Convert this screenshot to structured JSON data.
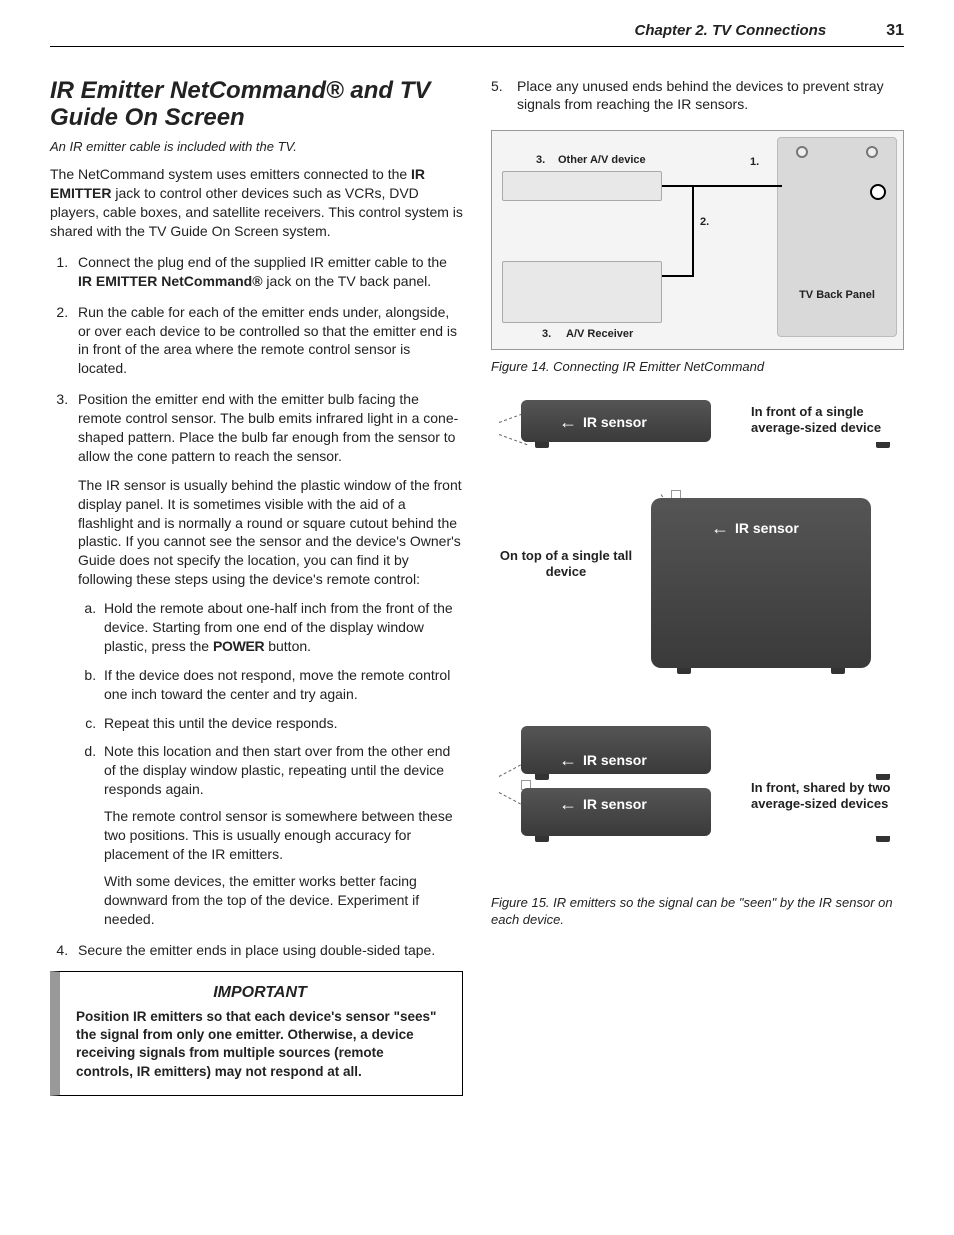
{
  "header": {
    "chapter": "Chapter 2. TV Connections",
    "page": "31"
  },
  "section": {
    "title": "IR Emitter NetCommand® and TV Guide On Screen",
    "subtitle": "An IR emitter cable is included with the TV.",
    "intro_a": "The NetCommand system uses emitters connected to the ",
    "intro_bold": "IR EMITTER",
    "intro_b": " jack to control other devices such as VCRs, DVD players, cable boxes, and satellite receivers.  This control system is shared with the TV Guide On Screen system."
  },
  "steps": {
    "s1_a": "Connect the plug end of the supplied IR emitter cable to the ",
    "s1_bold": "IR EMITTER NetCommand®",
    "s1_b": " jack on the TV back panel.",
    "s2": "Run the cable for each of the emitter ends under, alongside, or over each device to be controlled so that the emitter end is in front of the area where the remote control sensor is located.",
    "s3_p1": "Position the emitter end with the emitter bulb facing the remote control sensor.  The bulb emits infrared light in a cone-shaped pattern.  Place the bulb far enough from the sensor to allow the cone pattern to reach the sensor.",
    "s3_p2": "The IR sensor is usually behind the plastic window of the front display panel.  It is sometimes visible with the aid of a flashlight and is normally a round or square cutout behind the plastic.  If you cannot see the sensor and the device's Owner's Guide does not specify the location, you can find it by following these steps using the device's remote control:",
    "s3a_a": "Hold the remote about one-half inch from the front of the device.  Starting from one end of the display window plastic, press the ",
    "s3a_power": "POWER",
    "s3a_b": " button.",
    "s3b": "If the device does not respond, move the remote control one inch toward the center and try again.",
    "s3c": "Repeat this until the device responds.",
    "s3d": "Note this location and then start over from the other end of the display window plastic, repeating until the device responds again.",
    "s3_note1": "The remote control sensor is somewhere between these two positions.  This is usually enough accuracy for placement of the IR emitters.",
    "s3_note2": "With some devices, the emitter works better facing downward from the top of the device.  Experiment if needed.",
    "s4": "Secure the emitter ends in place using double-sided tape.",
    "s5": "Place any unused ends behind the devices to prevent stray signals from reaching the IR sensors."
  },
  "important": {
    "title": "IMPORTANT",
    "body": "Position IR emitters so that each device's sensor \"sees\" the signal from only one emitter.  Otherwise, a device receiving signals from multiple sources (remote controls, IR emitters) may not respond at all."
  },
  "fig14": {
    "caption": "Figure 14.  Connecting IR Emitter NetCommand",
    "labels": {
      "other": "Other A/V device",
      "av": "A/V Receiver",
      "back": "TV Back Panel",
      "n1": "1.",
      "n2": "2.",
      "n3a": "3.",
      "n3b": "3."
    }
  },
  "fig15": {
    "caption": "Figure 15.  IR emitters so the signal can be \"seen\" by the IR sensor on each device.",
    "ir_label": "IR sensor",
    "cap1": "In front of a single average-sized device",
    "cap2": "On top of a single tall device",
    "cap3": "In front, shared by two average-sized devices"
  }
}
